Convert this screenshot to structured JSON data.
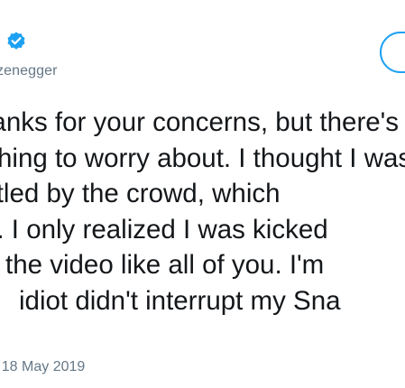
{
  "tweet": {
    "handle": "zenegger",
    "text_lines": [
      "Thanks for your concerns, but there's",
      "nothing to worry about. I thought I was",
      "jostled by the crowd, which",
      "d. I only realized I was kicked",
      "the video like all of you. I'm",
      "idiot didn't interrupt my Sna"
    ],
    "timestamp": "- 18 May 2019",
    "verified_icon": "verified-badge-icon",
    "colors": {
      "text": "#14171a",
      "secondary_text": "#657786",
      "accent": "#1da1f2"
    }
  }
}
